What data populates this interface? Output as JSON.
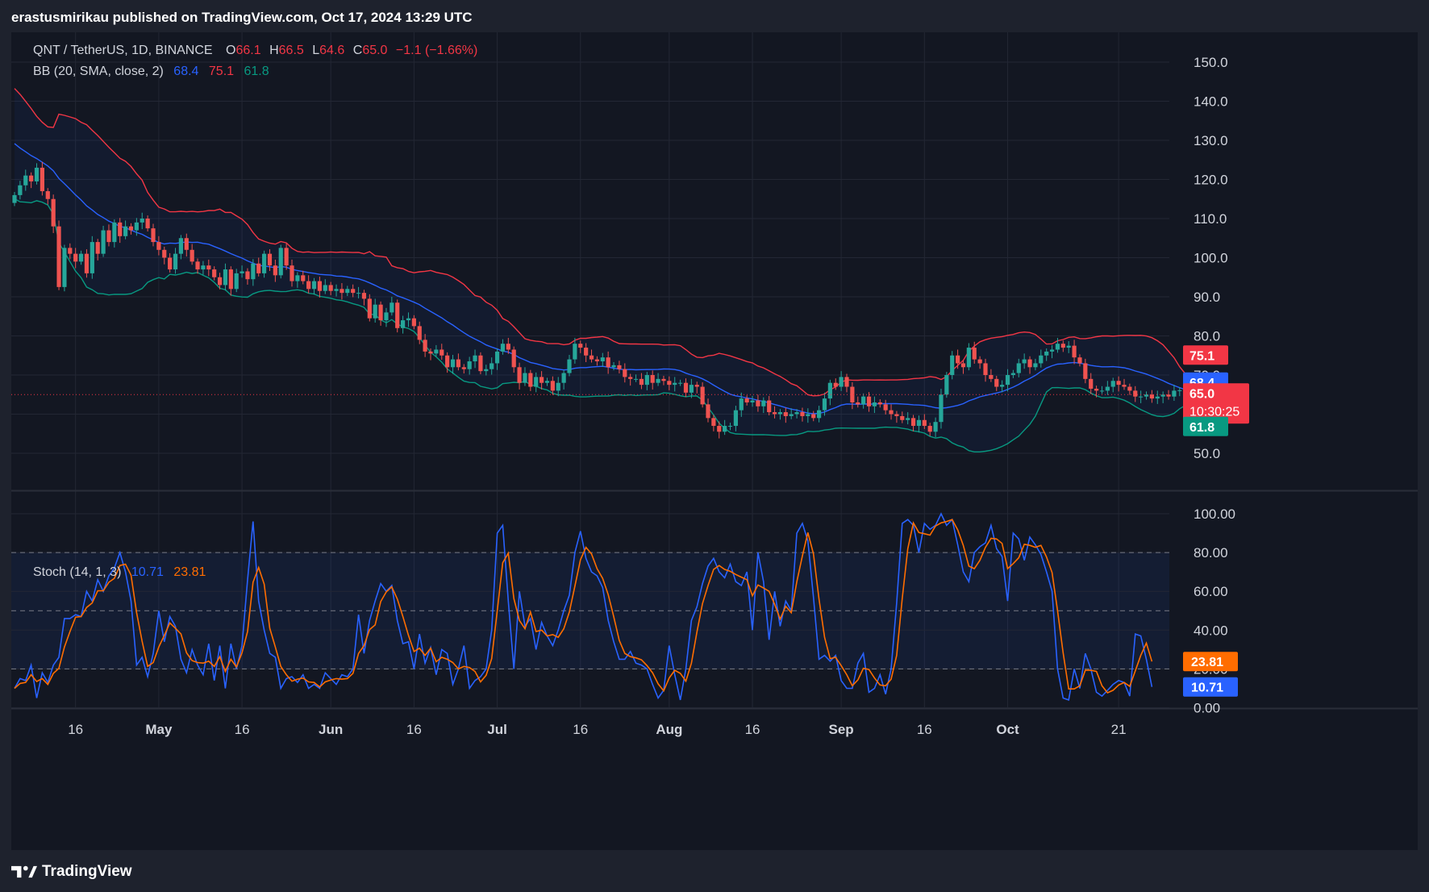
{
  "header": {
    "publisher_text": "erastusmirikau published on TradingView.com, Oct 17, 2024 13:29 UTC"
  },
  "brand": {
    "name": "TradingView"
  },
  "legend": {
    "symbol": "QNT / TetherUS, 1D, BINANCE",
    "open_label": "O",
    "open": "66.1",
    "high_label": "H",
    "high": "66.5",
    "low_label": "L",
    "low": "64.6",
    "close_label": "C",
    "close": "65.0",
    "change": "−1.1 (−1.66%)",
    "bb_label": "BB (20, SMA, close, 2)",
    "bb_basis": "68.4",
    "bb_upper": "75.1",
    "bb_lower": "61.8",
    "stoch_label": "Stoch (14, 1, 3)",
    "stoch_k": "10.71",
    "stoch_d": "23.81"
  },
  "colors": {
    "up": "#26a69a",
    "down": "#ef5350",
    "bb_basis": "#2962ff",
    "bb_upper": "#f23645",
    "bb_lower": "#089981",
    "stoch_k": "#2962ff",
    "stoch_d": "#ff6d00",
    "background": "#131722",
    "grid": "#232734",
    "text": "#d1d4dc"
  },
  "chart_data": [
    {
      "type": "candlestick",
      "title": "QNT / TetherUS, 1D, BINANCE",
      "ylim": [
        42,
        156
      ],
      "y_ticks": [
        "150.0",
        "140.0",
        "130.0",
        "120.0",
        "110.0",
        "100.0",
        "90.0",
        "80.0",
        "70.0",
        "60.0",
        "50.0"
      ],
      "x_ticks": [
        "16",
        "May",
        "16",
        "Jun",
        "16",
        "Jul",
        "16",
        "Aug",
        "16",
        "Sep",
        "16",
        "Oct",
        "21"
      ],
      "start_date": "2024-04-05",
      "current_price": {
        "value": 65.0,
        "label": "65.0",
        "countdown": "10:30:25"
      },
      "last_values": {
        "bb_upper": "75.1",
        "bb_basis": "68.4",
        "bb_lower": "61.8"
      },
      "close": [
        116.0,
        118.5,
        121.0,
        119.5,
        123.0,
        117.0,
        115.0,
        108.0,
        92.5,
        102.5,
        101.0,
        99.0,
        101.0,
        96.0,
        104.0,
        101.0,
        107.0,
        104.0,
        109.0,
        105.5,
        108.0,
        107.0,
        109.0,
        110.0,
        107.5,
        104.0,
        102.0,
        100.0,
        97.0,
        101.0,
        105.0,
        102.0,
        99.0,
        97.0,
        98.0,
        97.0,
        95.0,
        93.0,
        97.0,
        92.0,
        96.0,
        96.5,
        94.5,
        98.5,
        96.0,
        101.0,
        98.0,
        95.5,
        102.5,
        98.0,
        94.0,
        95.5,
        94.0,
        92.0,
        94.0,
        91.5,
        93.0,
        91.5,
        92.0,
        91.0,
        92.0,
        91.0,
        91.0,
        89.5,
        84.5,
        88.0,
        84.0,
        86.0,
        88.5,
        82.0,
        84.0,
        84.5,
        82.5,
        79.0,
        76.0,
        75.5,
        76.5,
        75.0,
        72.0,
        74.0,
        72.0,
        71.5,
        73.5,
        75.0,
        71.0,
        71.5,
        73.0,
        76.0,
        78.0,
        76.5,
        72.0,
        68.0,
        70.5,
        67.0,
        69.5,
        68.0,
        68.5,
        66.0,
        68.0,
        70.5,
        74.0,
        78.0,
        77.0,
        75.0,
        74.0,
        73.5,
        74.5,
        72.0,
        72.5,
        71.5,
        69.5,
        69.0,
        69.0,
        67.5,
        70.0,
        68.0,
        69.0,
        68.5,
        67.5,
        68.0,
        68.0,
        65.5,
        67.5,
        67.0,
        62.5,
        59.0,
        57.0,
        55.5,
        57.0,
        57.0,
        61.0,
        64.0,
        63.0,
        63.5,
        62.0,
        63.5,
        60.5,
        60.0,
        60.5,
        59.5,
        60.0,
        60.5,
        59.5,
        60.0,
        59.0,
        61.0,
        64.0,
        68.0,
        67.0,
        69.5,
        67.0,
        63.0,
        62.5,
        64.5,
        62.0,
        63.0,
        62.5,
        61.0,
        60.0,
        59.5,
        58.5,
        59.0,
        57.0,
        58.5,
        57.0,
        55.5,
        58.0,
        65.0,
        70.0,
        75.0,
        73.0,
        72.0,
        77.0,
        74.0,
        73.0,
        70.0,
        69.0,
        67.0,
        67.5,
        70.0,
        70.5,
        73.0,
        74.0,
        72.0,
        73.0,
        75.0,
        76.0,
        76.5,
        78.0,
        77.0,
        77.5,
        74.5,
        73.0,
        69.0,
        66.5,
        66.0,
        66.0,
        67.0,
        68.5,
        67.5,
        67.0,
        66.0,
        64.5,
        64.5,
        65.0,
        64.0,
        64.5,
        65.0,
        64.5,
        66.0,
        66.1,
        65.0
      ],
      "series": [
        {
          "name": "BB upper"
        },
        {
          "name": "BB basis"
        },
        {
          "name": "BB lower"
        }
      ]
    },
    {
      "type": "line",
      "title": "Stoch (14, 1, 3)",
      "ylim": [
        -8,
        108
      ],
      "y_ticks": [
        "100.00",
        "80.00",
        "60.00",
        "40.00",
        "20.00",
        "0.00"
      ],
      "bands": [
        80,
        50,
        20
      ],
      "last_values": {
        "k": "10.71",
        "d": "23.81"
      },
      "series": [
        {
          "name": "%K",
          "values": [
            10.0,
            15.0,
            14.0,
            22.0,
            5.0,
            18.0,
            13.0,
            22.0,
            26.0,
            46.0,
            46.0,
            48.0,
            47.0,
            60.0,
            55.0,
            66.0,
            60.0,
            68.0,
            72.0,
            80.0,
            70.0,
            55.0,
            22.0,
            26.0,
            16.0,
            28.0,
            50.0,
            34.0,
            47.0,
            42.0,
            25.0,
            18.0,
            30.0,
            22.0,
            17.0,
            33.0,
            14.0,
            32.0,
            10.0,
            33.0,
            20.0,
            32.0,
            66.0,
            96.0,
            55.0,
            40.0,
            28.0,
            26.0,
            10.0,
            15.0,
            16.0,
            13.0,
            17.0,
            10.0,
            12.0,
            10.0,
            18.0,
            15.0,
            12.0,
            17.0,
            16.0,
            20.0,
            48.0,
            28.0,
            45.0,
            55.0,
            64.0,
            60.0,
            63.0,
            45.0,
            33.0,
            34.0,
            20.0,
            38.0,
            23.0,
            31.0,
            17.0,
            30.0,
            28.0,
            12.0,
            20.0,
            32.0,
            10.0,
            14.0,
            16.0,
            20.0,
            40.0,
            90.0,
            94.0,
            55.0,
            20.0,
            60.0,
            42.0,
            46.0,
            30.0,
            44.0,
            37.0,
            32.0,
            40.0,
            50.0,
            58.0,
            80.0,
            91.0,
            77.0,
            70.0,
            68.0,
            62.0,
            45.0,
            34.0,
            25.0,
            25.0,
            29.0,
            23.0,
            22.0,
            20.0,
            12.0,
            5.0,
            9.0,
            32.0,
            17.0,
            4.0,
            20.0,
            45.0,
            52.0,
            64.0,
            73.0,
            77.0,
            70.0,
            67.0,
            74.0,
            65.0,
            63.0,
            70.0,
            40.0,
            80.0,
            65.0,
            35.0,
            60.0,
            42.0,
            55.0,
            50.0,
            90.0,
            95.0,
            86.0,
            57.0,
            25.0,
            27.0,
            24.0,
            27.0,
            14.0,
            10.0,
            10.0,
            23.0,
            28.0,
            8.0,
            10.0,
            17.0,
            7.0,
            20.0,
            54.0,
            95.0,
            97.0,
            94.0,
            80.0,
            95.0,
            92.0,
            94.0,
            100.0,
            94.0,
            97.0,
            84.0,
            70.0,
            65.0,
            80.0,
            83.0,
            85.0,
            94.0,
            82.0,
            78.0,
            55.0,
            90.0,
            87.0,
            76.0,
            88.0,
            84.0,
            79.0,
            70.0,
            60.0,
            20.0,
            5.0,
            4.0,
            20.0,
            10.0,
            28.0,
            20.0,
            8.0,
            6.0,
            9.0,
            12.0,
            14.0,
            13.0,
            6.0,
            38.0,
            37.0,
            25.0,
            10.71
          ]
        },
        {
          "name": "%D",
          "values": [
            10.0,
            12.5,
            13.0,
            17.0,
            13.5,
            15.0,
            12.0,
            17.7,
            20.3,
            31.3,
            39.3,
            46.7,
            47.0,
            51.7,
            54.0,
            60.3,
            60.3,
            64.7,
            66.7,
            73.3,
            74.0,
            68.3,
            49.0,
            34.3,
            21.3,
            23.3,
            31.3,
            37.3,
            43.7,
            41.0,
            38.0,
            28.3,
            24.3,
            23.3,
            23.0,
            24.0,
            21.3,
            26.3,
            18.7,
            25.0,
            21.0,
            28.3,
            39.3,
            64.7,
            72.3,
            63.7,
            41.0,
            31.3,
            21.3,
            17.0,
            13.7,
            14.7,
            15.3,
            13.3,
            13.0,
            10.7,
            13.3,
            14.3,
            15.0,
            14.7,
            15.0,
            17.7,
            28.0,
            32.0,
            40.3,
            42.7,
            54.7,
            59.7,
            62.3,
            56.0,
            47.0,
            37.3,
            29.0,
            30.7,
            27.0,
            30.7,
            23.7,
            26.0,
            25.0,
            23.3,
            20.0,
            21.3,
            20.7,
            18.7,
            13.3,
            16.7,
            25.3,
            50.0,
            74.7,
            79.7,
            56.3,
            45.0,
            40.7,
            49.3,
            39.3,
            40.0,
            37.0,
            37.7,
            36.3,
            40.7,
            49.3,
            62.7,
            76.3,
            82.7,
            79.3,
            71.7,
            66.7,
            58.3,
            47.0,
            34.7,
            28.0,
            26.3,
            25.7,
            24.7,
            21.7,
            18.0,
            12.3,
            8.7,
            15.3,
            19.3,
            17.7,
            13.7,
            23.0,
            39.0,
            53.7,
            63.0,
            71.3,
            73.3,
            71.3,
            70.3,
            68.7,
            67.3,
            66.0,
            57.7,
            63.3,
            61.7,
            60.0,
            53.3,
            45.7,
            52.3,
            49.0,
            65.0,
            78.3,
            90.3,
            79.3,
            56.0,
            36.3,
            25.3,
            26.0,
            21.7,
            17.0,
            11.3,
            14.3,
            20.3,
            19.7,
            15.3,
            11.7,
            11.3,
            14.7,
            27.0,
            56.3,
            82.0,
            95.3,
            90.3,
            89.7,
            89.0,
            93.7,
            95.3,
            96.0,
            97.0,
            91.7,
            83.7,
            73.0,
            71.7,
            76.0,
            82.7,
            87.3,
            87.0,
            84.7,
            71.7,
            74.3,
            77.3,
            84.3,
            83.7,
            82.7,
            83.7,
            77.7,
            69.7,
            50.0,
            28.3,
            9.7,
            9.7,
            11.3,
            19.3,
            19.3,
            18.7,
            11.3,
            7.7,
            9.0,
            11.7,
            13.0,
            11.0,
            19.0,
            27.0,
            33.3,
            23.81
          ]
        }
      ]
    }
  ]
}
